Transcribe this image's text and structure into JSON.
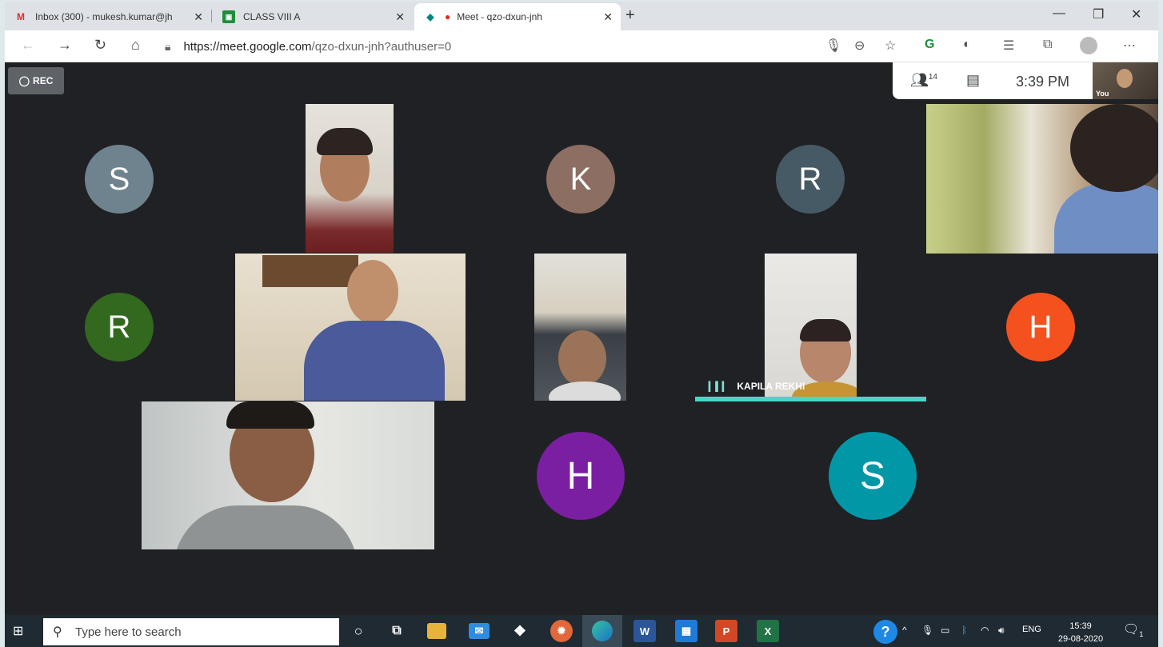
{
  "browser": {
    "tabs": [
      {
        "title": "Inbox (300) - mukesh.kumar@jh",
        "icon": "gmail-icon"
      },
      {
        "title": "CLASS VIII A",
        "icon": "classroom-icon"
      },
      {
        "title": "Meet - qzo-dxun-jnh",
        "icon": "meet-icon",
        "active": true
      }
    ],
    "url_domain": "https://meet.google.com",
    "url_path": "/qzo-dxun-jnh?authuser=0"
  },
  "meet": {
    "rec_label": "REC",
    "participant_count": "14",
    "time": "3:39 PM",
    "self_label": "You",
    "speaker_name": "KAPILA REKHI",
    "avatars": [
      {
        "letter": "S",
        "color": "#6f838f"
      },
      {
        "letter": "K",
        "color": "#8d6e63"
      },
      {
        "letter": "R",
        "color": "#455a64"
      },
      {
        "letter": "R",
        "color": "#33691e"
      },
      {
        "letter": "H",
        "color": "#f4511e"
      },
      {
        "letter": "H",
        "color": "#7b1fa2"
      },
      {
        "letter": "S",
        "color": "#0097a7"
      }
    ]
  },
  "taskbar": {
    "search_placeholder": "Type here to search",
    "lang": "ENG",
    "clock_time": "15:39",
    "clock_date": "29-08-2020",
    "notification_count": "1"
  }
}
